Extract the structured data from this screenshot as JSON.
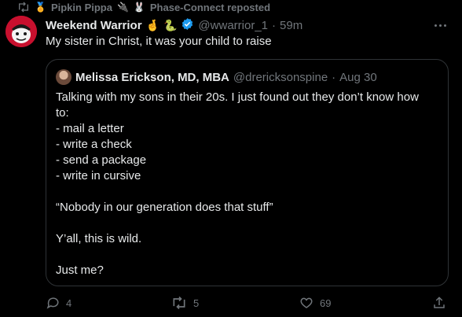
{
  "repost": {
    "icon": "repost-icon",
    "badge_1": "🏅",
    "user_1": "Pipkin Pippa",
    "badge_2": "🔌",
    "badge_3": "🐰",
    "user_2": "Phase-Connect reposted"
  },
  "tweet": {
    "author_name": "Weekend Warrior",
    "author_emoji_1": "🤞",
    "author_emoji_2": "🐍",
    "handle": "@wwarrior_1",
    "separator": "·",
    "time": "59m",
    "text": "My sister in Christ, it was your child to raise"
  },
  "quote": {
    "author_name": "Melissa Erickson, MD, MBA",
    "handle": "@drericksonspine",
    "separator": "·",
    "date": "Aug 30",
    "lines": [
      "Talking with my sons in their 20s. I just found out they don’t know how",
      "to:",
      "- mail a letter",
      "- write a check",
      "- send a package",
      "- write in cursive",
      "",
      "“Nobody in our generation does that stuff”",
      "",
      "Y’all, this is wild.",
      "",
      "Just me?"
    ]
  },
  "actions": {
    "replies": "4",
    "reposts": "5",
    "likes": "69"
  },
  "colors": {
    "background": "#000000",
    "text": "#e7e9ea",
    "muted": "#71767b",
    "verified": "#1d9bf0",
    "border": "#2f3336",
    "avatar": "#c8102e"
  }
}
